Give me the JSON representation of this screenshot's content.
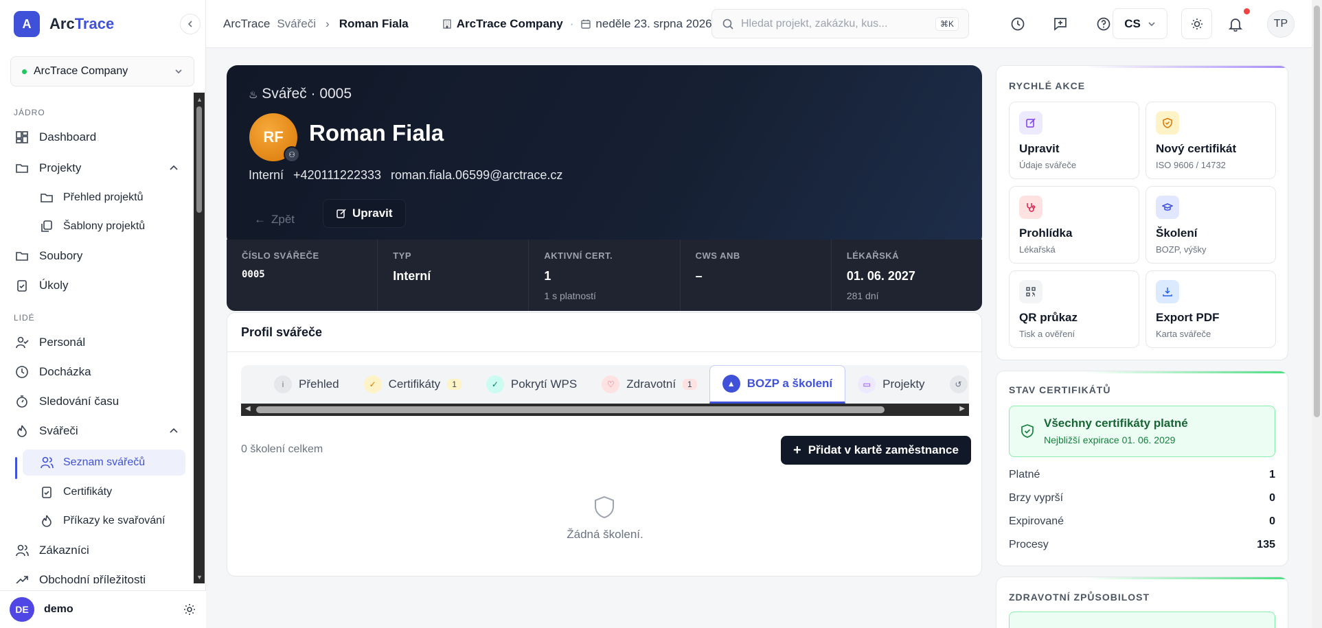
{
  "brand": {
    "logo_letter": "A",
    "name_a": "Arc",
    "name_b": "Trace"
  },
  "sidebar": {
    "company": "ArcTrace Company",
    "sections": {
      "core": "JÁDRO",
      "people": "LIDÉ"
    },
    "items": {
      "dashboard": "Dashboard",
      "projects": "Projekty",
      "projects_overview": "Přehled projektů",
      "project_templates": "Šablony projektů",
      "files": "Soubory",
      "tasks": "Úkoly",
      "personnel": "Personál",
      "attendance": "Docházka",
      "time_tracking": "Sledování času",
      "welders": "Svářeči",
      "welder_list": "Seznam svářečů",
      "certificates": "Certifikáty",
      "welding_orders": "Příkazy ke svařování",
      "customers": "Zákazníci",
      "opportunities": "Obchodní příležitosti"
    },
    "user": {
      "initials": "DE",
      "name": "demo"
    }
  },
  "topbar": {
    "crumb1": "ArcTrace",
    "crumb2": "Svářeči",
    "crumb3": "Roman Fiala",
    "company": "ArcTrace Company",
    "date": "neděle 23. srpna 2026",
    "search_placeholder": "Hledat projekt, zakázku, kus...",
    "search_kbd": "⌘K",
    "lang": "CS",
    "user_initials": "TP"
  },
  "hero": {
    "subtitle": "Svářeč · 0005",
    "initials": "RF",
    "name": "Roman Fiala",
    "type": "Interní",
    "phone": "+420111222333",
    "email": "roman.fiala.06599@arctrace.cz",
    "back_label": "Zpět",
    "edit_label": "Upravit"
  },
  "stats": [
    {
      "label": "ČÍSLO SVÁŘEČE",
      "value": "0005",
      "note": ""
    },
    {
      "label": "TYP",
      "value": "Interní",
      "note": ""
    },
    {
      "label": "AKTIVNÍ CERT.",
      "value": "1",
      "note": "1 s platností"
    },
    {
      "label": "CWS ANB",
      "value": "–",
      "note": ""
    },
    {
      "label": "LÉKAŘSKÁ",
      "value": "01. 06. 2027",
      "note": "281 dní"
    }
  ],
  "profile": {
    "title": "Profil svářeče",
    "tabs": [
      {
        "label": "Přehled",
        "count": ""
      },
      {
        "label": "Certifikáty",
        "count": "1"
      },
      {
        "label": "Pokrytí WPS",
        "count": ""
      },
      {
        "label": "Zdravotní",
        "count": "1"
      },
      {
        "label": "BOZP a školení",
        "count": ""
      },
      {
        "label": "Projekty",
        "count": ""
      }
    ],
    "count_text": "0 školení celkem",
    "add_label": "Přidat v kartě zaměstnance",
    "empty_text": "Žádná školení."
  },
  "quick_actions": {
    "title": "RYCHLÉ AKCE",
    "tiles": [
      {
        "title": "Upravit",
        "sub": "Údaje svářeče"
      },
      {
        "title": "Nový certifikát",
        "sub": "ISO 9606 / 14732"
      },
      {
        "title": "Prohlídka",
        "sub": "Lékařská"
      },
      {
        "title": "Školení",
        "sub": "BOZP, výšky"
      },
      {
        "title": "QR průkaz",
        "sub": "Tisk a ověření"
      },
      {
        "title": "Export PDF",
        "sub": "Karta svářeče"
      }
    ]
  },
  "cert_status": {
    "title": "STAV CERTIFIKÁTŮ",
    "ok_title": "Všechny certifikáty platné",
    "ok_sub": "Nejbližší expirace 01. 06. 2029",
    "rows": [
      {
        "label": "Platné",
        "value": "1"
      },
      {
        "label": "Brzy vyprší",
        "value": "0"
      },
      {
        "label": "Expirované",
        "value": "0"
      },
      {
        "label": "Procesy",
        "value": "135"
      }
    ]
  },
  "health": {
    "title": "ZDRAVOTNÍ ZPŮSOBILOST"
  },
  "colors": {
    "accent": "#3f51d8",
    "hero_bg": "#111827",
    "success": "#15803d",
    "notification": "#ef4444"
  }
}
